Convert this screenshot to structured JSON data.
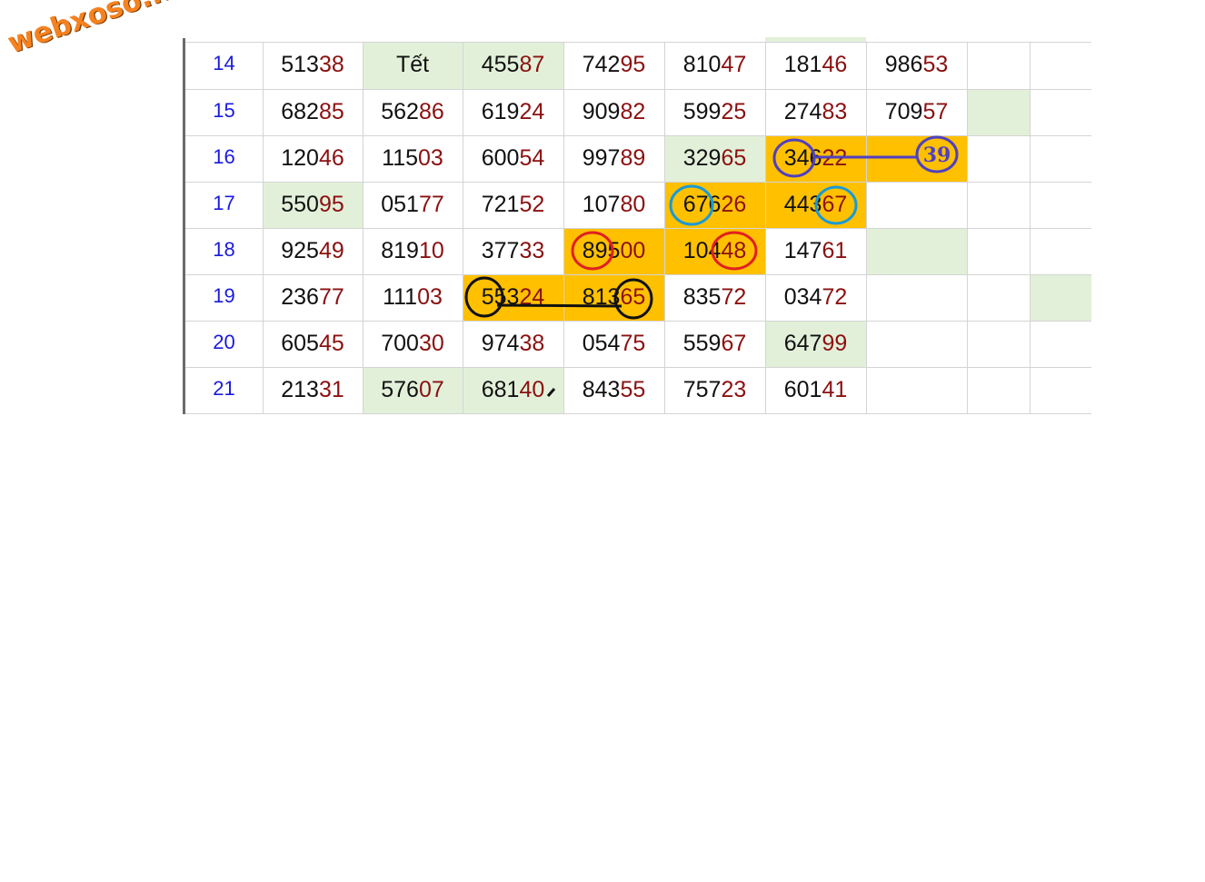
{
  "watermark": "webxoso.net",
  "rows": [
    {
      "num": "14",
      "cells": [
        [
          "513",
          "38"
        ],
        [
          "Tết",
          ""
        ],
        [
          "455",
          "87"
        ],
        [
          "742",
          "95"
        ],
        [
          "810",
          "47"
        ],
        [
          "181",
          "46"
        ],
        [
          "986",
          "53"
        ]
      ]
    },
    {
      "num": "15",
      "cells": [
        [
          "682",
          "85"
        ],
        [
          "562",
          "86"
        ],
        [
          "619",
          "24"
        ],
        [
          "909",
          "82"
        ],
        [
          "599",
          "25"
        ],
        [
          "274",
          "83"
        ],
        [
          "709",
          "57"
        ]
      ]
    },
    {
      "num": "16",
      "cells": [
        [
          "120",
          "46"
        ],
        [
          "115",
          "03"
        ],
        [
          "600",
          "54"
        ],
        [
          "997",
          "89"
        ],
        [
          "329",
          "65"
        ],
        [
          "346",
          "22"
        ],
        [
          "",
          ""
        ]
      ]
    },
    {
      "num": "17",
      "cells": [
        [
          "550",
          "95"
        ],
        [
          "051",
          "77"
        ],
        [
          "721",
          "52"
        ],
        [
          "107",
          "80"
        ],
        [
          "676",
          "26"
        ],
        [
          "443",
          "67"
        ],
        [
          "",
          ""
        ]
      ]
    },
    {
      "num": "18",
      "cells": [
        [
          "925",
          "49"
        ],
        [
          "819",
          "10"
        ],
        [
          "377",
          "33"
        ],
        [
          "895",
          "00"
        ],
        [
          "104",
          "48"
        ],
        [
          "147",
          "61"
        ],
        [
          "",
          ""
        ]
      ]
    },
    {
      "num": "19",
      "cells": [
        [
          "236",
          "77"
        ],
        [
          "111",
          "03"
        ],
        [
          "553",
          "24"
        ],
        [
          "813",
          "65"
        ],
        [
          "835",
          "72"
        ],
        [
          "034",
          "72"
        ],
        [
          "",
          ""
        ]
      ]
    },
    {
      "num": "20",
      "cells": [
        [
          "605",
          "45"
        ],
        [
          "700",
          "30"
        ],
        [
          "974",
          "38"
        ],
        [
          "054",
          "75"
        ],
        [
          "559",
          "67"
        ],
        [
          "647",
          "99"
        ],
        [
          "",
          ""
        ]
      ]
    },
    {
      "num": "21",
      "cells": [
        [
          "213",
          "31"
        ],
        [
          "576",
          "07"
        ],
        [
          "681",
          "40"
        ],
        [
          "843",
          "55"
        ],
        [
          "757",
          "23"
        ],
        [
          "601",
          "41"
        ],
        [
          "",
          ""
        ]
      ]
    }
  ],
  "annotations": {
    "circle_label": "39"
  },
  "colors": {
    "highlight_green": "#e2f0d9",
    "highlight_orange": "#ffc000",
    "tail_digits": "#8b1010",
    "row_numbers": "#1a1add",
    "circle_purple": "#5040c0",
    "circle_blue": "#1a9ad6",
    "circle_red": "#e02020",
    "circle_black": "#111111"
  }
}
